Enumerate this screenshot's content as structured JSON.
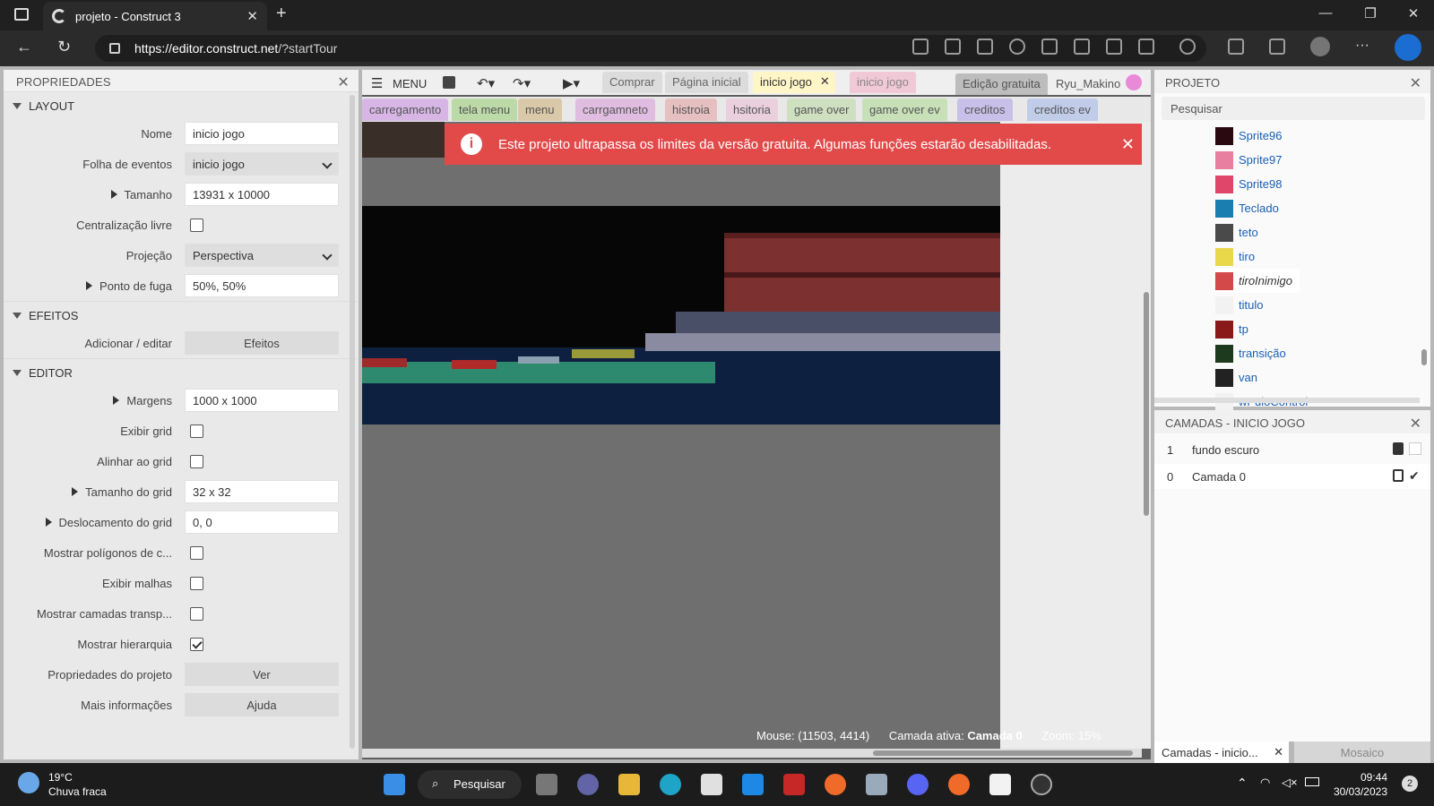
{
  "browser": {
    "tab_title": "projeto - Construct 3",
    "url_host": "https://editor.construct.net",
    "url_path": "/?startTour"
  },
  "props": {
    "title": "PROPRIEDADES",
    "sections": {
      "layout": "LAYOUT",
      "efeitos": "EFEITOS",
      "editor": "EDITOR"
    },
    "rows": {
      "nome": {
        "label": "Nome",
        "value": "inicio jogo"
      },
      "folha": {
        "label": "Folha de eventos",
        "value": "inicio jogo"
      },
      "tamanho": {
        "label": "Tamanho",
        "value": "13931 x 10000"
      },
      "centralizacao": {
        "label": "Centralização livre",
        "checked": false
      },
      "projecao": {
        "label": "Projeção",
        "value": "Perspectiva"
      },
      "ponto": {
        "label": "Ponto de fuga",
        "value": "50%, 50%"
      },
      "adicionar": {
        "label": "Adicionar / editar",
        "button": "Efeitos"
      },
      "margens": {
        "label": "Margens",
        "value": "1000 x 1000"
      },
      "exibir_grid": {
        "label": "Exibir grid",
        "checked": false
      },
      "alinhar_grid": {
        "label": "Alinhar ao grid",
        "checked": false
      },
      "tamanho_grid": {
        "label": "Tamanho do grid",
        "value": "32 x 32"
      },
      "deslocamento": {
        "label": "Deslocamento do grid",
        "value": "0, 0"
      },
      "poligonos": {
        "label": "Mostrar polígonos de c...",
        "checked": false
      },
      "malhas": {
        "label": "Exibir malhas",
        "checked": false
      },
      "camadas_transp": {
        "label": "Mostrar camadas transp...",
        "checked": false
      },
      "hierarquia": {
        "label": "Mostrar hierarquia",
        "checked": true
      },
      "prop_projeto": {
        "label": "Propriedades do projeto",
        "button": "Ver"
      },
      "mais_info": {
        "label": "Mais informações",
        "button": "Ajuda"
      }
    }
  },
  "toolbar": {
    "menu": "MENU",
    "comprar": "Comprar",
    "pagina_inicial": "Página inicial",
    "tab_active": "inicio jogo",
    "tab_events": "inicio jogo",
    "edicao": "Edição gratuita",
    "user": "Ryu_Makino"
  },
  "layout_tabs": [
    "carregamento",
    "tela menu",
    "menu",
    "carrgamneto",
    "histroia",
    "hsitoria",
    "game over",
    "game over ev",
    "creditos",
    "creditos ev"
  ],
  "banner": "Este projeto ultrapassa os limites da versão gratuita. Algumas funções estarão desabilitadas.",
  "status": {
    "mouse": "Mouse: (11503, 4414)",
    "camada_label": "Camada ativa:",
    "camada_value": "Camada 0",
    "zoom": "Zoom: 15%"
  },
  "project": {
    "title": "PROJETO",
    "search_placeholder": "Pesquisar",
    "objects": [
      {
        "name": "Sprite96",
        "color": "#2a0a10"
      },
      {
        "name": "Sprite97",
        "color": "#e97fa0"
      },
      {
        "name": "Sprite98",
        "color": "#e0456a"
      },
      {
        "name": "Teclado",
        "color": "#1a7fb0"
      },
      {
        "name": "teto",
        "color": "#4a4a4a"
      },
      {
        "name": "tiro",
        "color": "#e8d84a"
      },
      {
        "name": "tiroInimigo",
        "color": "#d34848"
      },
      {
        "name": "titulo",
        "color": "#f2f2f2"
      },
      {
        "name": "tp",
        "color": "#8a1a1a"
      },
      {
        "name": "transição",
        "color": "#1e3a1e"
      },
      {
        "name": "van",
        "color": "#222222"
      },
      {
        "name": "wPuloControl",
        "color": "#f2f2f2"
      }
    ]
  },
  "layers": {
    "title": "CAMADAS - INICIO JOGO",
    "rows": [
      {
        "num": "1",
        "name": "fundo escuro"
      },
      {
        "num": "0",
        "name": "Camada 0"
      }
    ],
    "tab_a": "Camadas - inicio...",
    "tab_b": "Mosaico"
  },
  "taskbar": {
    "temp": "19°C",
    "weather": "Chuva fraca",
    "search": "Pesquisar",
    "time": "09:44",
    "date": "30/03/2023",
    "badge": "2"
  }
}
